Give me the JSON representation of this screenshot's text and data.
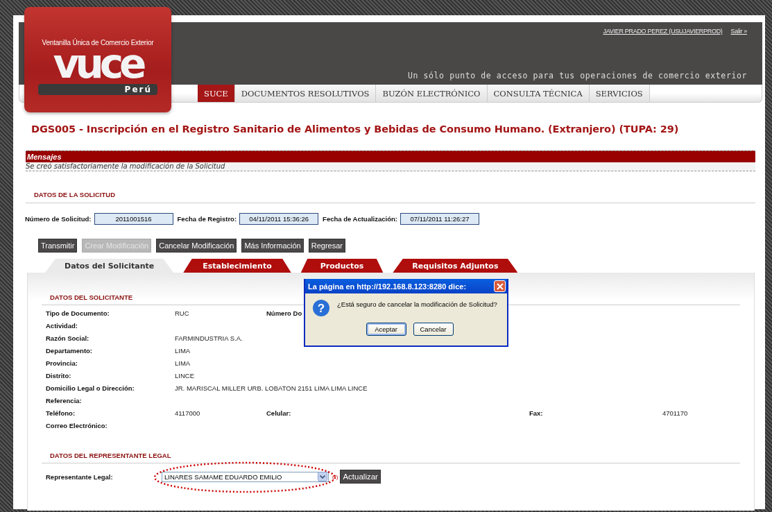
{
  "header": {
    "logo": {
      "subtitle": "Ventanilla Única de Comercio Exterior",
      "wordmark": "vuce",
      "country": "Perú"
    },
    "user_link": "JAVIER PRADO PEREZ (USUJAVIERPROD)",
    "logout_link": "Salir »",
    "tagline": "Un sólo punto de acceso para tus operaciones de comercio exterior"
  },
  "nav": [
    {
      "label": "SUCE",
      "selected": true
    },
    {
      "label": "DOCUMENTOS RESOLUTIVOS",
      "selected": false
    },
    {
      "label": "BUZÓN ELECTRÓNICO",
      "selected": false
    },
    {
      "label": "CONSULTA TÉCNICA",
      "selected": false
    },
    {
      "label": "SERVICIOS",
      "selected": false
    }
  ],
  "title": "DGS005 - Inscripción en el Registro Sanitario de Alimentos y Bebidas de Consumo Humano. (Extranjero) (TUPA: 29)",
  "messages": {
    "title": "Mensajes",
    "text": "Se creó satisfactoriamente la modificación de la Solicitud"
  },
  "solicitud": {
    "heading": "DATOS DE LA SOLICITUD",
    "fields": [
      {
        "label": "Número de Solicitud:",
        "value": "2011001516"
      },
      {
        "label": "Fecha de Registro:",
        "value": "04/11/2011 15:36:26"
      },
      {
        "label": "Fecha de Actualización:",
        "value": "07/11/2011 11:26:27"
      }
    ]
  },
  "actions": [
    {
      "label": "Transmitir",
      "disabled": false
    },
    {
      "label": "Crear Modificación",
      "disabled": true
    },
    {
      "label": "Cancelar Modificación",
      "disabled": false
    },
    {
      "label": "Más Información",
      "disabled": false
    },
    {
      "label": "Regresar",
      "disabled": false
    }
  ],
  "tabs": [
    {
      "label": "Datos del Solicitante",
      "selected": true
    },
    {
      "label": "Establecimiento",
      "selected": false
    },
    {
      "label": "Productos",
      "selected": false
    },
    {
      "label": "Requisitos Adjuntos",
      "selected": false
    }
  ],
  "solicitante": {
    "heading": "DATOS DEL SOLICITANTE",
    "rows": [
      {
        "pairs": [
          {
            "label": "Tipo de Documento:",
            "value": "RUC"
          },
          {
            "label": "Número Do"
          }
        ]
      },
      {
        "pairs": [
          {
            "label": "Actividad:"
          }
        ]
      },
      {
        "pairs": [
          {
            "label": "Razón Social:",
            "value": "FARMINDUSTRIA S.A."
          }
        ]
      },
      {
        "pairs": [
          {
            "label": "Departamento:",
            "value": "LIMA"
          }
        ]
      },
      {
        "pairs": [
          {
            "label": "Provincia:",
            "value": "LIMA"
          }
        ]
      },
      {
        "pairs": [
          {
            "label": "Distrito:",
            "value": "LINCE"
          }
        ]
      },
      {
        "pairs": [
          {
            "label": "Domicilio Legal o Dirección:",
            "value": "JR. MARISCAL MILLER URB. LOBATON 2151 LIMA LIMA LINCE"
          }
        ]
      },
      {
        "pairs": [
          {
            "label": "Referencia:"
          }
        ]
      },
      {
        "pairs": [
          {
            "label": "Teléfono:",
            "value": "4117000"
          },
          {
            "label": "Celular:"
          },
          {
            "label": "Fax:",
            "value": "4701170"
          }
        ]
      },
      {
        "pairs": [
          {
            "label": "Correo Electrónico:"
          }
        ]
      }
    ]
  },
  "representante": {
    "heading": "DATOS DEL REPRESENTANTE LEGAL",
    "label": "Representante Legal:",
    "value": "LINARES SAMAME EDUARDO EMILIO",
    "required_mark": "(*)",
    "button": "Actualizar",
    "highlighted": true
  },
  "dialog": {
    "icon": "?",
    "title": "La página en http://192.168.8.123:8280 dice:",
    "message": "¿Está seguro de cancelar la modificación de Solicitud?",
    "buttons": [
      {
        "label": "Aceptar",
        "selected": true
      },
      {
        "label": "Cancelar",
        "selected": false
      }
    ]
  }
}
